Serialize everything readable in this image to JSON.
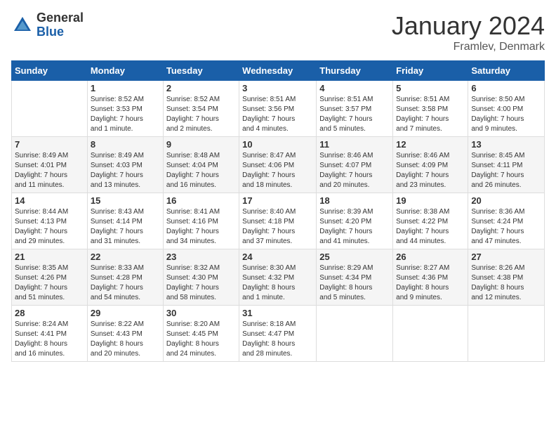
{
  "header": {
    "logo_general": "General",
    "logo_blue": "Blue",
    "month_title": "January 2024",
    "location": "Framlev, Denmark"
  },
  "days_of_week": [
    "Sunday",
    "Monday",
    "Tuesday",
    "Wednesday",
    "Thursday",
    "Friday",
    "Saturday"
  ],
  "weeks": [
    [
      {
        "day": "",
        "info": ""
      },
      {
        "day": "1",
        "info": "Sunrise: 8:52 AM\nSunset: 3:53 PM\nDaylight: 7 hours\nand 1 minute."
      },
      {
        "day": "2",
        "info": "Sunrise: 8:52 AM\nSunset: 3:54 PM\nDaylight: 7 hours\nand 2 minutes."
      },
      {
        "day": "3",
        "info": "Sunrise: 8:51 AM\nSunset: 3:56 PM\nDaylight: 7 hours\nand 4 minutes."
      },
      {
        "day": "4",
        "info": "Sunrise: 8:51 AM\nSunset: 3:57 PM\nDaylight: 7 hours\nand 5 minutes."
      },
      {
        "day": "5",
        "info": "Sunrise: 8:51 AM\nSunset: 3:58 PM\nDaylight: 7 hours\nand 7 minutes."
      },
      {
        "day": "6",
        "info": "Sunrise: 8:50 AM\nSunset: 4:00 PM\nDaylight: 7 hours\nand 9 minutes."
      }
    ],
    [
      {
        "day": "7",
        "info": "Sunrise: 8:49 AM\nSunset: 4:01 PM\nDaylight: 7 hours\nand 11 minutes."
      },
      {
        "day": "8",
        "info": "Sunrise: 8:49 AM\nSunset: 4:03 PM\nDaylight: 7 hours\nand 13 minutes."
      },
      {
        "day": "9",
        "info": "Sunrise: 8:48 AM\nSunset: 4:04 PM\nDaylight: 7 hours\nand 16 minutes."
      },
      {
        "day": "10",
        "info": "Sunrise: 8:47 AM\nSunset: 4:06 PM\nDaylight: 7 hours\nand 18 minutes."
      },
      {
        "day": "11",
        "info": "Sunrise: 8:46 AM\nSunset: 4:07 PM\nDaylight: 7 hours\nand 20 minutes."
      },
      {
        "day": "12",
        "info": "Sunrise: 8:46 AM\nSunset: 4:09 PM\nDaylight: 7 hours\nand 23 minutes."
      },
      {
        "day": "13",
        "info": "Sunrise: 8:45 AM\nSunset: 4:11 PM\nDaylight: 7 hours\nand 26 minutes."
      }
    ],
    [
      {
        "day": "14",
        "info": "Sunrise: 8:44 AM\nSunset: 4:13 PM\nDaylight: 7 hours\nand 29 minutes."
      },
      {
        "day": "15",
        "info": "Sunrise: 8:43 AM\nSunset: 4:14 PM\nDaylight: 7 hours\nand 31 minutes."
      },
      {
        "day": "16",
        "info": "Sunrise: 8:41 AM\nSunset: 4:16 PM\nDaylight: 7 hours\nand 34 minutes."
      },
      {
        "day": "17",
        "info": "Sunrise: 8:40 AM\nSunset: 4:18 PM\nDaylight: 7 hours\nand 37 minutes."
      },
      {
        "day": "18",
        "info": "Sunrise: 8:39 AM\nSunset: 4:20 PM\nDaylight: 7 hours\nand 41 minutes."
      },
      {
        "day": "19",
        "info": "Sunrise: 8:38 AM\nSunset: 4:22 PM\nDaylight: 7 hours\nand 44 minutes."
      },
      {
        "day": "20",
        "info": "Sunrise: 8:36 AM\nSunset: 4:24 PM\nDaylight: 7 hours\nand 47 minutes."
      }
    ],
    [
      {
        "day": "21",
        "info": "Sunrise: 8:35 AM\nSunset: 4:26 PM\nDaylight: 7 hours\nand 51 minutes."
      },
      {
        "day": "22",
        "info": "Sunrise: 8:33 AM\nSunset: 4:28 PM\nDaylight: 7 hours\nand 54 minutes."
      },
      {
        "day": "23",
        "info": "Sunrise: 8:32 AM\nSunset: 4:30 PM\nDaylight: 7 hours\nand 58 minutes."
      },
      {
        "day": "24",
        "info": "Sunrise: 8:30 AM\nSunset: 4:32 PM\nDaylight: 8 hours\nand 1 minute."
      },
      {
        "day": "25",
        "info": "Sunrise: 8:29 AM\nSunset: 4:34 PM\nDaylight: 8 hours\nand 5 minutes."
      },
      {
        "day": "26",
        "info": "Sunrise: 8:27 AM\nSunset: 4:36 PM\nDaylight: 8 hours\nand 9 minutes."
      },
      {
        "day": "27",
        "info": "Sunrise: 8:26 AM\nSunset: 4:38 PM\nDaylight: 8 hours\nand 12 minutes."
      }
    ],
    [
      {
        "day": "28",
        "info": "Sunrise: 8:24 AM\nSunset: 4:41 PM\nDaylight: 8 hours\nand 16 minutes."
      },
      {
        "day": "29",
        "info": "Sunrise: 8:22 AM\nSunset: 4:43 PM\nDaylight: 8 hours\nand 20 minutes."
      },
      {
        "day": "30",
        "info": "Sunrise: 8:20 AM\nSunset: 4:45 PM\nDaylight: 8 hours\nand 24 minutes."
      },
      {
        "day": "31",
        "info": "Sunrise: 8:18 AM\nSunset: 4:47 PM\nDaylight: 8 hours\nand 28 minutes."
      },
      {
        "day": "",
        "info": ""
      },
      {
        "day": "",
        "info": ""
      },
      {
        "day": "",
        "info": ""
      }
    ]
  ]
}
